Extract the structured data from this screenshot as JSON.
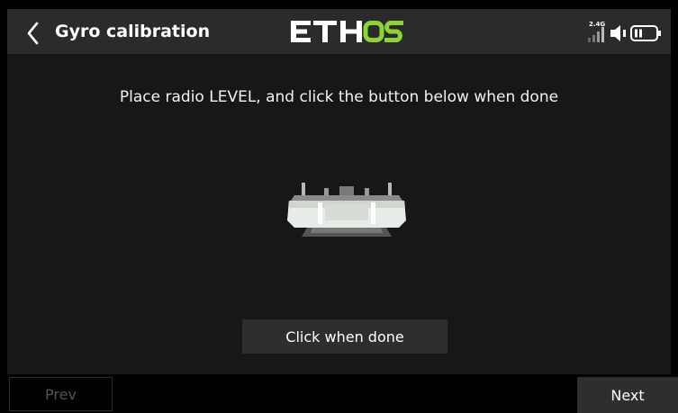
{
  "header": {
    "title": "Gyro calibration",
    "logo_text": "ETHOS",
    "signal_label": "2.4G",
    "icons": [
      "back-chevron-icon",
      "signal-bars-icon",
      "speaker-icon",
      "battery-icon"
    ]
  },
  "main": {
    "instruction": "Place radio LEVEL, and click the button below when done",
    "image": "radio-transmitter-level-icon",
    "button_label": "Click when done"
  },
  "footer": {
    "prev_label": "Prev",
    "prev_enabled": false,
    "next_label": "Next"
  },
  "colors": {
    "background": "#000000",
    "panel": "#171717",
    "header": "#2b2b2b",
    "button": "#2e2e2e",
    "logo_white": "#ffffff",
    "logo_accent": "#8ed334"
  }
}
